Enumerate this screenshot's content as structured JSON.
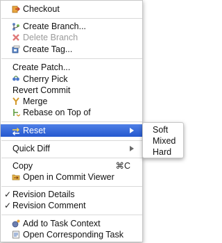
{
  "menu": {
    "items": [
      {
        "label": "Checkout",
        "icon": "checkout-icon"
      },
      {
        "label": "Create Branch...",
        "icon": "create-branch-icon"
      },
      {
        "label": "Delete Branch",
        "icon": "delete-branch-icon",
        "disabled": true
      },
      {
        "label": "Create Tag...",
        "icon": "create-tag-icon"
      },
      {
        "label": "Create Patch..."
      },
      {
        "label": "Cherry Pick",
        "icon": "cherry-pick-icon"
      },
      {
        "label": "Revert Commit"
      },
      {
        "label": "Merge",
        "icon": "merge-icon"
      },
      {
        "label": "Rebase on Top of",
        "icon": "rebase-icon"
      },
      {
        "label": "Reset",
        "icon": "reset-icon",
        "submenu": true,
        "highlighted": true
      },
      {
        "label": "Quick Diff",
        "submenu": true
      },
      {
        "label": "Copy",
        "shortcut": "⌘C"
      },
      {
        "label": "Open in Commit Viewer",
        "icon": "commit-viewer-icon"
      },
      {
        "label": "Revision Details",
        "checked": true
      },
      {
        "label": "Revision Comment",
        "checked": true
      },
      {
        "label": "Add to Task Context",
        "icon": "task-context-icon"
      },
      {
        "label": "Open Corresponding Task",
        "icon": "open-task-icon"
      }
    ]
  },
  "submenu": {
    "items": [
      "Soft",
      "Mixed",
      "Hard"
    ]
  },
  "check_mark": "✓",
  "colors": {
    "highlight_top": "#4f7fe6",
    "highlight_bottom": "#2559cf",
    "disabled_text": "#9b9b9b"
  }
}
